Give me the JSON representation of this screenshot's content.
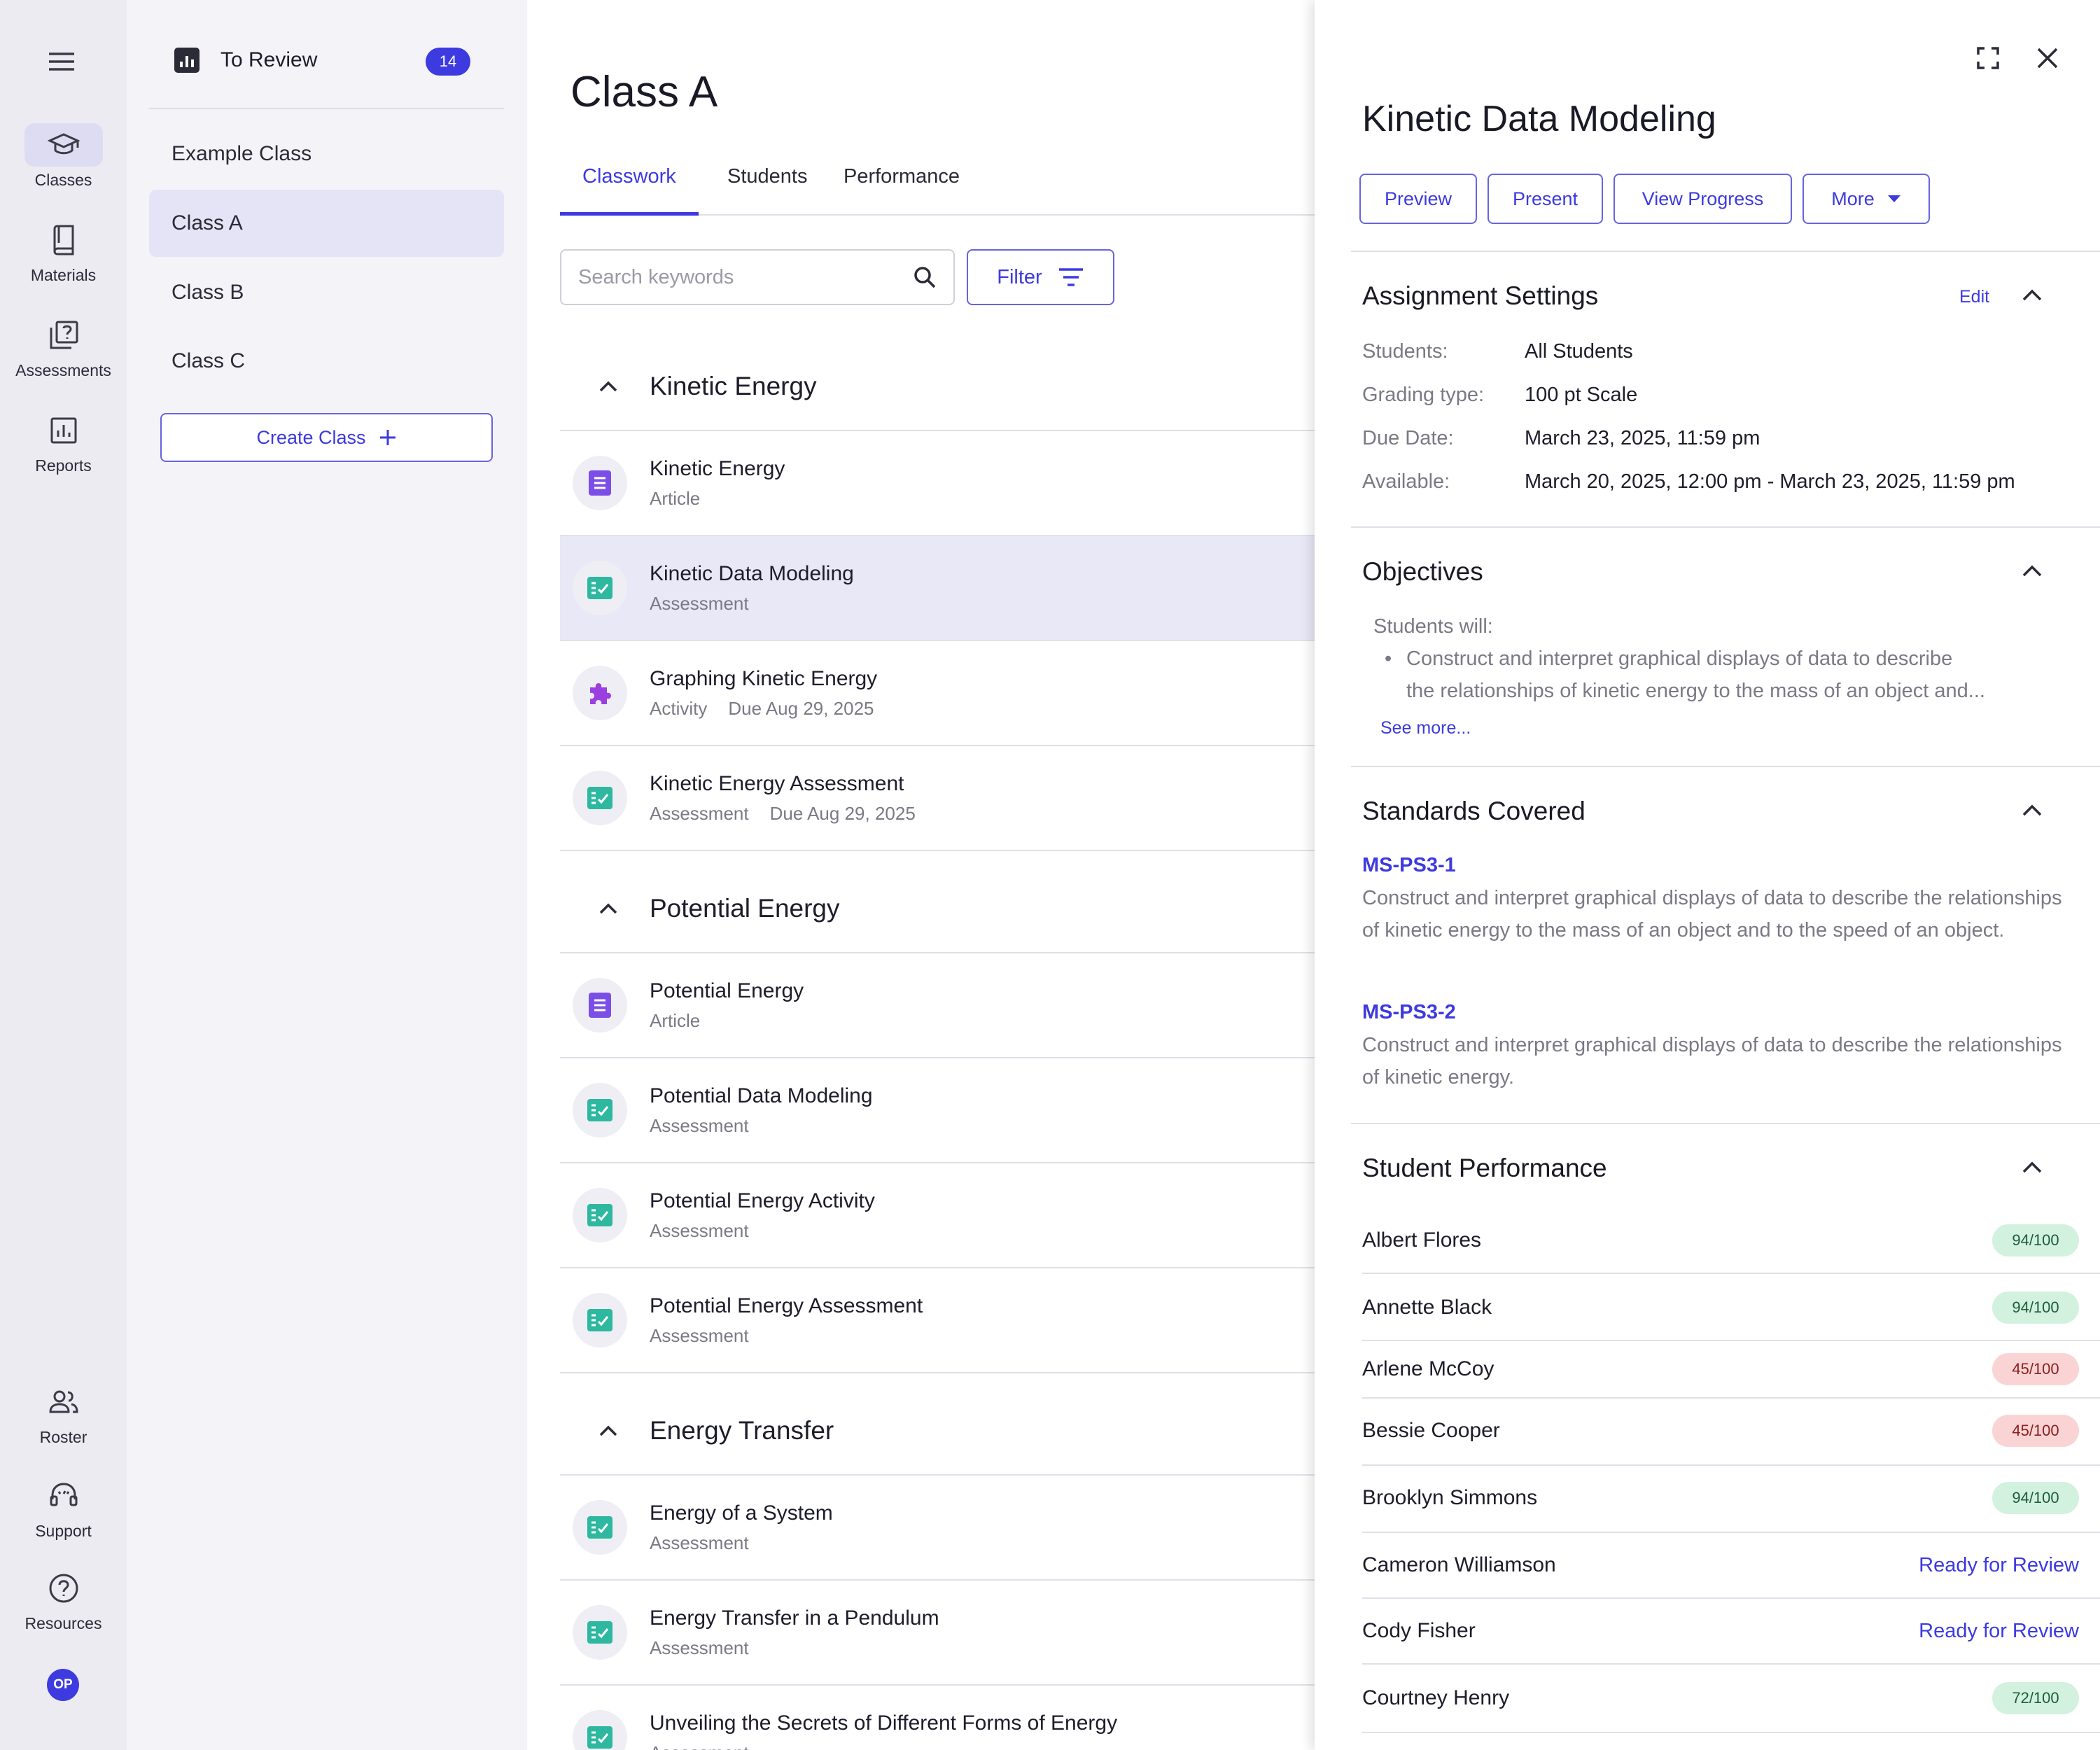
{
  "nav": {
    "items": [
      {
        "label": "Classes",
        "icon": "graduation-cap-icon"
      },
      {
        "label": "Materials",
        "icon": "book-icon"
      },
      {
        "label": "Assessments",
        "icon": "quiz-icon"
      },
      {
        "label": "Reports",
        "icon": "chart-icon"
      }
    ],
    "bottom": [
      {
        "label": "Roster",
        "icon": "people-icon"
      },
      {
        "label": "Support",
        "icon": "headset-icon"
      },
      {
        "label": "Resources",
        "icon": "help-icon"
      }
    ],
    "avatar": "OP"
  },
  "classes": {
    "to_review_label": "To Review",
    "to_review_count": "14",
    "items": [
      "Example Class",
      "Class A",
      "Class B",
      "Class C"
    ],
    "create_label": "Create Class"
  },
  "main": {
    "title": "Class A",
    "tabs": [
      "Classwork",
      "Students",
      "Performance"
    ],
    "search_placeholder": "Search keywords",
    "filter_label": "Filter",
    "sections": [
      {
        "title": "Kinetic Energy",
        "items": [
          {
            "title": "Kinetic Energy",
            "type": "Article",
            "due": ""
          },
          {
            "title": "Kinetic Data Modeling",
            "type": "Assessment",
            "due": ""
          },
          {
            "title": "Graphing Kinetic Energy",
            "type": "Activity",
            "due": "Due Aug 29, 2025"
          },
          {
            "title": "Kinetic Energy Assessment",
            "type": "Assessment",
            "due": "Due Aug 29, 2025"
          }
        ]
      },
      {
        "title": "Potential Energy",
        "items": [
          {
            "title": "Potential Energy",
            "type": "Article",
            "due": ""
          },
          {
            "title": "Potential Data Modeling",
            "type": "Assessment",
            "due": ""
          },
          {
            "title": "Potential Energy Activity",
            "type": "Assessment",
            "due": ""
          },
          {
            "title": "Potential Energy Assessment",
            "type": "Assessment",
            "due": ""
          }
        ]
      },
      {
        "title": "Energy Transfer",
        "items": [
          {
            "title": "Energy of a System",
            "type": "Assessment",
            "due": ""
          },
          {
            "title": "Energy Transfer in a Pendulum",
            "type": "Assessment",
            "due": ""
          },
          {
            "title": "Unveiling the Secrets of Different Forms of Energy",
            "type": "Assessment",
            "due": ""
          }
        ]
      }
    ]
  },
  "panel": {
    "title": "Kinetic Data Modeling",
    "buttons": {
      "preview": "Preview",
      "present": "Present",
      "view_progress": "View Progress",
      "more": "More"
    },
    "settings": {
      "heading": "Assignment Settings",
      "edit": "Edit",
      "rows": [
        {
          "k": "Students:",
          "v": "All Students"
        },
        {
          "k": "Grading type:",
          "v": "100 pt Scale"
        },
        {
          "k": "Due Date:",
          "v": "March 23, 2025, 11:59 pm"
        },
        {
          "k": "Available:",
          "v": "March 20, 2025, 12:00 pm - March 23, 2025, 11:59 pm"
        }
      ]
    },
    "objectives": {
      "heading": "Objectives",
      "intro": "Students will:",
      "bullet_line1": "Construct and interpret graphical displays of data to describe",
      "bullet_line2": "the relationships of kinetic energy to the mass of an object and...",
      "see_more": "See more..."
    },
    "standards": {
      "heading": "Standards Covered",
      "items": [
        {
          "code": "MS-PS3-1",
          "desc": "Construct and interpret graphical displays of data to describe the relationships of kinetic energy to the mass of an object and to the speed of an object."
        },
        {
          "code": "MS-PS3-2",
          "desc": "Construct and interpret graphical displays of data to describe the relationships of kinetic energy."
        }
      ]
    },
    "performance": {
      "heading": "Student Performance",
      "students": [
        {
          "name": "Albert Flores",
          "score": "94/100",
          "status": "good"
        },
        {
          "name": "Annette Black",
          "score": "94/100",
          "status": "good"
        },
        {
          "name": "Arlene McCoy",
          "score": "45/100",
          "status": "bad"
        },
        {
          "name": "Bessie Cooper",
          "score": "45/100",
          "status": "bad"
        },
        {
          "name": "Brooklyn Simmons",
          "score": "94/100",
          "status": "good"
        },
        {
          "name": "Cameron Williamson",
          "score": "Ready for Review",
          "status": "review"
        },
        {
          "name": "Cody Fisher",
          "score": "Ready for Review",
          "status": "review"
        },
        {
          "name": "Courtney Henry",
          "score": "72/100",
          "status": "good"
        }
      ]
    }
  },
  "colors": {
    "accent": "#3d3ae0",
    "article": "#7b4ee8",
    "assessment": "#2eb8a0",
    "activity": "#9b3fe0"
  }
}
